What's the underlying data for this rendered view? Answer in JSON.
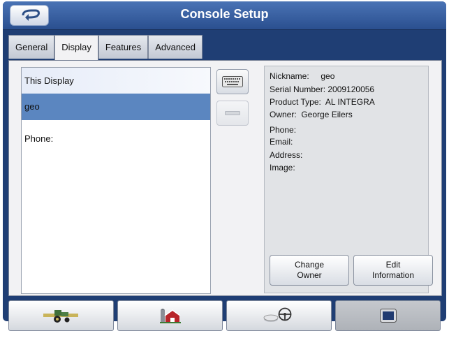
{
  "window": {
    "title": "Console Setup"
  },
  "tabs": [
    {
      "label": "General",
      "active": false
    },
    {
      "label": "Display",
      "active": true
    },
    {
      "label": "Features",
      "active": false
    },
    {
      "label": "Advanced",
      "active": false
    }
  ],
  "display_list": {
    "header": "This Display",
    "selected_item": "geo",
    "phone_label": "Phone:"
  },
  "details": {
    "nickname": "Nickname:     geo",
    "serial": "Serial Number: 2009120056",
    "product": "Product Type:  AL INTEGRA",
    "owner": "Owner:  George Eilers",
    "phone": "Phone:",
    "email": "Email:",
    "address": "Address:",
    "image": "Image:"
  },
  "buttons": {
    "change_owner_line1": "Change",
    "change_owner_line2": "Owner",
    "edit_info_line1": "Edit",
    "edit_info_line2": "Information"
  },
  "icons": {
    "back": "back-arrow-icon",
    "keyboard": "keyboard-icon",
    "minus": "minus-icon",
    "tractor": "tractor-icon",
    "farm": "barn-silo-icon",
    "guidance": "steering-wheel-icon",
    "display": "display-screen-icon"
  },
  "colors": {
    "frame": "#1f3e74",
    "title_bar": "#3a63a6",
    "selected_row": "#5b86c0"
  }
}
